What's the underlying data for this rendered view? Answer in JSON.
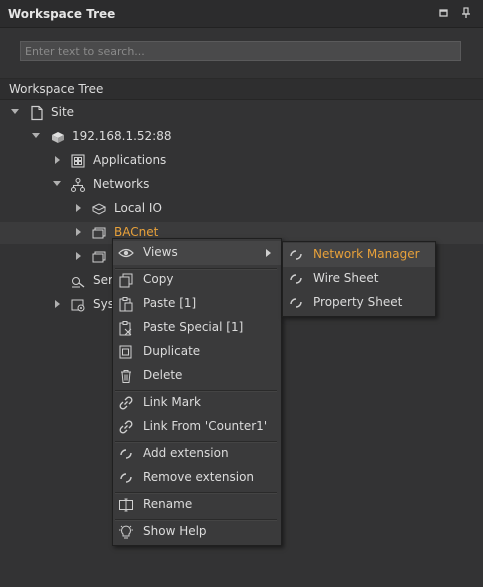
{
  "panel": {
    "title": "Workspace Tree"
  },
  "search": {
    "placeholder": "Enter text to search..."
  },
  "tree": {
    "header": "Workspace Tree",
    "site": "Site",
    "station": "192.168.1.52:88",
    "applications": "Applications",
    "networks": "Networks",
    "local_io": "Local IO",
    "bacnet": "BACnet",
    "services_partial": "Ser",
    "system_partial": "Sys"
  },
  "context_menu": {
    "views": "Views",
    "copy": "Copy",
    "paste": "Paste [1]",
    "paste_special": "Paste Special [1]",
    "duplicate": "Duplicate",
    "delete": "Delete",
    "link_mark": "Link Mark",
    "link_from": "Link From 'Counter1'",
    "add_extension": "Add extension",
    "remove_extension": "Remove extension",
    "rename": "Rename",
    "show_help": "Show Help"
  },
  "views_submenu": {
    "network_manager": "Network Manager",
    "wire_sheet": "Wire Sheet",
    "property_sheet": "Property Sheet"
  },
  "colors": {
    "accent": "#e8a13a",
    "background": "#333334",
    "menu": "#3a3a3b"
  }
}
